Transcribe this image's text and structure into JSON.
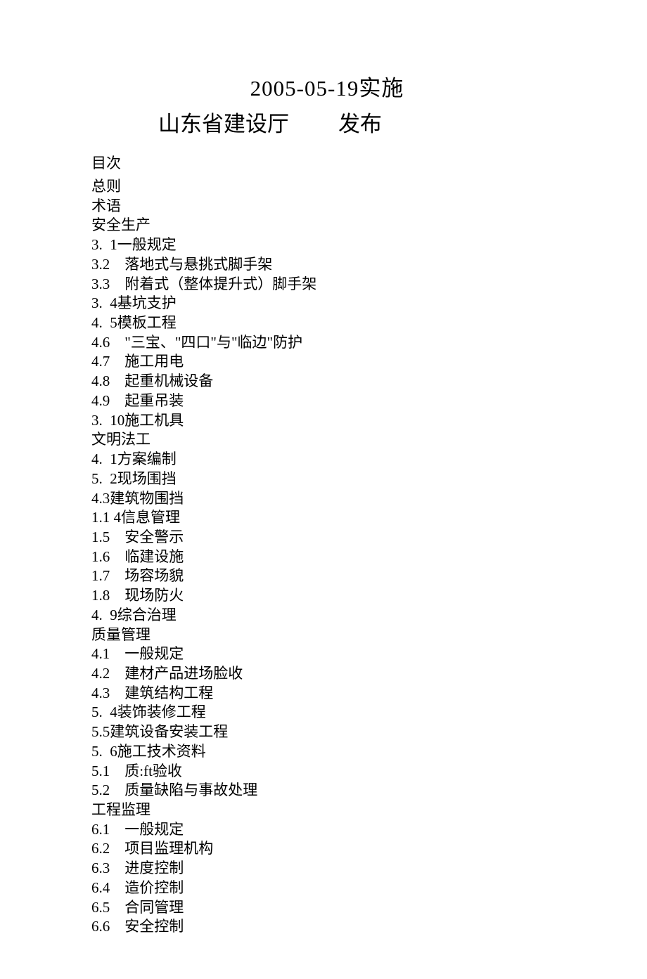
{
  "title": {
    "line1": "2005-05-19实施",
    "line2_left": "山东省建设厅",
    "line2_right": "发布"
  },
  "heading": "目次",
  "toc": [
    "总则",
    "术语",
    "安全生产",
    "3.  1一般规定",
    "3.2    落地式与悬挑式脚手架",
    "3.3    附着式（整体提升式）脚手架",
    "3.  4基坑支护",
    "4.  5模板工程",
    "4.6    \"三宝、\"四口\"与\"临边\"防护",
    "4.7    施工用电",
    "4.8    起重机械设备",
    "4.9    起重吊装",
    "3.  10施工机具",
    "文明法工",
    "4.  1方案编制",
    "5.  2现场围挡",
    "4.3建筑物围挡",
    "1.1 4信息管理",
    "1.5    安全警示",
    "1.6    临建设施",
    "1.7    场容场貌",
    "1.8    现场防火",
    "4.  9综合治理",
    "质量管理",
    "4.1    一般规定",
    "4.2    建材产品进场脸收",
    "4.3    建筑结构工程",
    "5.  4装饰装修工程",
    "5.5建筑设备安装工程",
    "5.  6施工技术资料",
    "5.1    质:ft验收",
    "5.2    质量缺陷与事故处理",
    "工程监理",
    "6.1    一般规定",
    "6.2    项目监理机构",
    "6.3    进度控制",
    "6.4    造价控制",
    "6.5    合同管理",
    "6.6    安全控制"
  ]
}
